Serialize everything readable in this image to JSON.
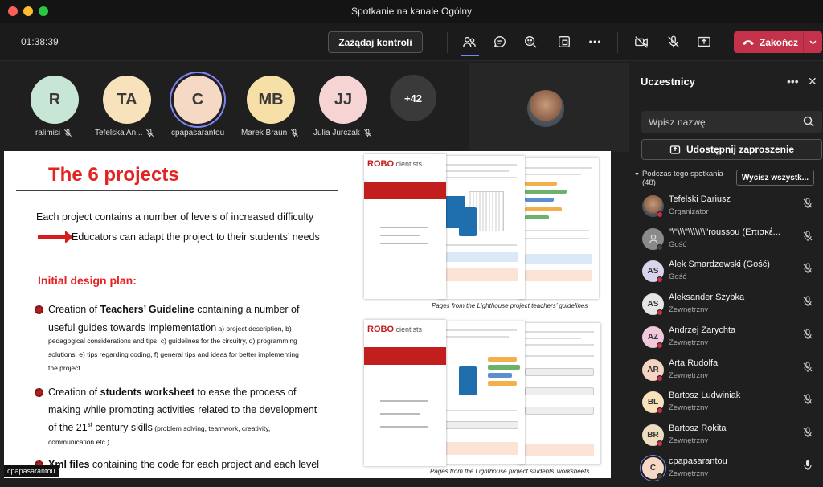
{
  "window": {
    "title": "Spotkanie na kanale Ogólny"
  },
  "toolbar": {
    "timer": "01:38:39",
    "request_control": "Zażądaj kontroli",
    "end_label": "Zakończ",
    "icons": [
      "people-icon",
      "chat-icon",
      "reactions-icon",
      "rooms-icon",
      "more-icon",
      "camera-off-icon",
      "mic-off-icon",
      "share-icon"
    ]
  },
  "avatars": [
    {
      "initials": "R",
      "name": "ralimisi",
      "color": "#c8e6d6"
    },
    {
      "initials": "TA",
      "name": "Tefelska An...",
      "color": "#f7e2bc"
    },
    {
      "initials": "C",
      "name": "cpapasarantou",
      "color": "#f5d9c4"
    },
    {
      "initials": "MB",
      "name": "Marek Braun",
      "color": "#f7e0a8"
    },
    {
      "initials": "JJ",
      "name": "Julia Jurczak",
      "color": "#f7d4d4"
    }
  ],
  "more_count": "+42",
  "slide": {
    "title": "The 6 projects",
    "intro": "Each project contains a number of levels of increased difficulty",
    "arrow_text": "Educators can adapt the project to their students’ needs",
    "plan_head": "Initial design plan:",
    "b1_a": "Creation of ",
    "b1_b": "Teachers’ Guideline",
    "b1_c": " containing a number of",
    "b1_line2": "useful guides towards implementation",
    "b1_small1": " a) project description, b)",
    "b1_small2": "pedagogical considerations and tips, c) guidelines for the circuitry, d) programming",
    "b1_small3": "solutions, e) tips regarding coding, f) general tips and ideas for better implementing",
    "b1_small4": "the project",
    "b2_a": "Creation of ",
    "b2_b": "students worksheet",
    "b2_c": " to ease the process of",
    "b2_line2": "making while promoting activities related to the development",
    "b2_line3a": "of the 21",
    "b2_sup": "st",
    "b2_line3b": " century skills",
    "b2_small": " (problem solving, teamwork, creativity,",
    "b2_line4": "communication etc.)",
    "b3_a": "Xml files",
    "b3_b": " containing the code for each project and each level",
    "caption1": "Pages from the Lighthouse project teachers’ guidelines",
    "caption2": "Pages from the Lighthouse project students’ worksheets",
    "robo": "ROBO",
    "scientists": "cientists",
    "sharer_name": "cpapasarantou"
  },
  "panel": {
    "title": "Uczestnicy",
    "search_placeholder": "Wpisz nazwę",
    "share_invite": "Udostępnij zaproszenie",
    "group_label": "Podczas tego spotkania",
    "group_count": "(48)",
    "mute_all": "Wycisz wszystk...",
    "participants": [
      {
        "name": "Tefelski Dariusz",
        "role": "Organizator",
        "initials": "",
        "color": "#6a6a6a",
        "photo": true
      },
      {
        "name": "\"\\\"\\\\\\\"\\\\\\\\\\\\\\\"roussou (Επισκέ...",
        "role": "Gość",
        "initials": "",
        "color": "#8a8a8a",
        "photo": false
      },
      {
        "name": "Alek Smardzewski (Gość)",
        "role": "Gość",
        "initials": "AS",
        "color": "#d9d4ec"
      },
      {
        "name": "Aleksander Szybka",
        "role": "Zewnętrzny",
        "initials": "AS",
        "color": "#e6e6e6"
      },
      {
        "name": "Andrzej Zarychta",
        "role": "Zewnętrzny",
        "initials": "AZ",
        "color": "#f0c8dc"
      },
      {
        "name": "Arta Rudolfa",
        "role": "Zewnętrzny",
        "initials": "AR",
        "color": "#f5d4c4"
      },
      {
        "name": "Bartosz Ludwiniak",
        "role": "Zewnętrzny",
        "initials": "BL",
        "color": "#f7e2bc"
      },
      {
        "name": "Bartosz Rokita",
        "role": "Zewnętrzny",
        "initials": "BR",
        "color": "#f0dcc0"
      },
      {
        "name": "cpapasarantou",
        "role": "Zewnętrzny",
        "initials": "C",
        "color": "#f5d9c4"
      }
    ]
  },
  "colors": {
    "accent": "#7f85f5",
    "end": "#c4314b",
    "slide_red": "#e32222"
  }
}
